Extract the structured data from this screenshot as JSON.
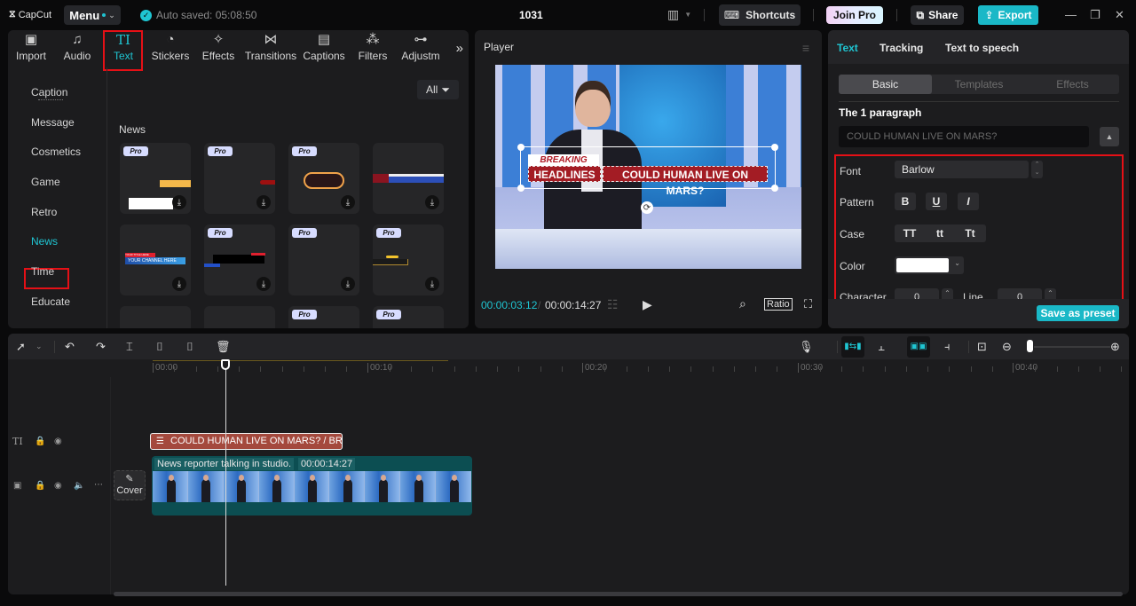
{
  "topbar": {
    "logo": "CapCut",
    "menu_label": "Menu",
    "autosave": "Auto saved: 05:08:50",
    "project_title": "1031",
    "shortcuts_label": "Shortcuts",
    "join_pro_label": "Join Pro",
    "share_label": "Share",
    "export_label": "Export",
    "window": {
      "minimize": "—",
      "restore": "❐",
      "close": "✕"
    }
  },
  "media_panel": {
    "tabs": [
      {
        "label": "Import",
        "icon": "▣"
      },
      {
        "label": "Audio",
        "icon": "♫"
      },
      {
        "label": "Text",
        "icon": "TI"
      },
      {
        "label": "Stickers",
        "icon": "◔"
      },
      {
        "label": "Effects",
        "icon": "✧"
      },
      {
        "label": "Transitions",
        "icon": "⋈"
      },
      {
        "label": "Captions",
        "icon": "▤"
      },
      {
        "label": "Filters",
        "icon": "⁂"
      },
      {
        "label": "Adjustm",
        "icon": "⊶"
      }
    ],
    "more_icon": "»",
    "categories": [
      "Caption",
      "Message",
      "Cosmetics",
      "Game",
      "Retro",
      "News",
      "Time",
      "Educate"
    ],
    "active_category": "News",
    "filter_label": "All",
    "section_title": "News",
    "pro_badge": "Pro",
    "download_icon": "⤓",
    "card_preview_texts": {
      "channel": "YOUR CHANNEL HERE",
      "title": "YOUR TITLE HERE"
    }
  },
  "player": {
    "title": "Player",
    "overlay": {
      "tag": "BREAKING NEWS",
      "headline": "HEADLINES",
      "main": "COULD HUMAN LIVE ON MARS?"
    },
    "current_time": "00:00:03:12",
    "total_time": "00:00:14:27",
    "ratio_label": "Ratio"
  },
  "properties": {
    "tabs": [
      "Text",
      "Tracking",
      "Text to speech"
    ],
    "active_tab": "Text",
    "subtabs": [
      "Basic",
      "Templates",
      "Effects"
    ],
    "paragraph_title": "The 1 paragraph",
    "paragraph_text": "COULD HUMAN LIVE ON MARS?",
    "font_label": "Font",
    "font_value": "Barlow",
    "pattern_label": "Pattern",
    "pattern_buttons": [
      "B",
      "U",
      "I"
    ],
    "case_label": "Case",
    "case_buttons": [
      "TT",
      "tt",
      "Tt"
    ],
    "color_label": "Color",
    "color_value": "#ffffff",
    "character_label": "Character",
    "character_value": "0",
    "line_label": "Line",
    "line_value": "0",
    "save_preset_label": "Save as preset"
  },
  "timeline": {
    "ruler": [
      "00:00",
      "00:10",
      "00:20",
      "00:30",
      "00:40"
    ],
    "text_clip": "COULD HUMAN LIVE ON MARS? / BRE",
    "video_clip_name": "News reporter talking in studio.",
    "video_clip_duration": "00:00:14:27",
    "cover_label": "Cover"
  },
  "colors": {
    "accent": "#1fc5d2",
    "highlight_box": "#e51016",
    "text_clip": "#a4493d",
    "video_clip": "#0c4e52"
  }
}
